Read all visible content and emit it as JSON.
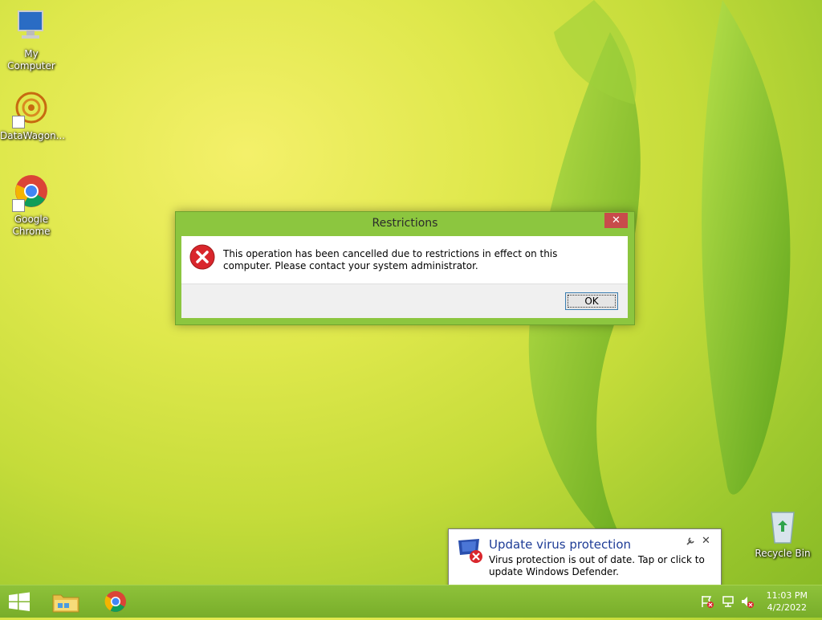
{
  "desktop": {
    "icons": [
      {
        "label": "My Computer"
      },
      {
        "label": "DataWagon..."
      },
      {
        "label": "Google Chrome"
      },
      {
        "label": "Recycle Bin"
      }
    ]
  },
  "dialog": {
    "title": "Restrictions",
    "close_label": "✕",
    "message": "This operation has been cancelled due to restrictions in effect on this computer. Please contact your system administrator.",
    "ok_label": "OK"
  },
  "notification": {
    "title": "Update virus protection",
    "text": "Virus protection is out of date. Tap or click to update Windows Defender.",
    "close_label": "✕"
  },
  "taskbar": {
    "clock_time": "11:03 PM",
    "clock_date": "4/2/2022"
  },
  "colors": {
    "dialog_frame": "#8cc63f",
    "taskbar": "#78ad2a",
    "error_red": "#d9262c",
    "notification_title": "#1e3c96"
  }
}
